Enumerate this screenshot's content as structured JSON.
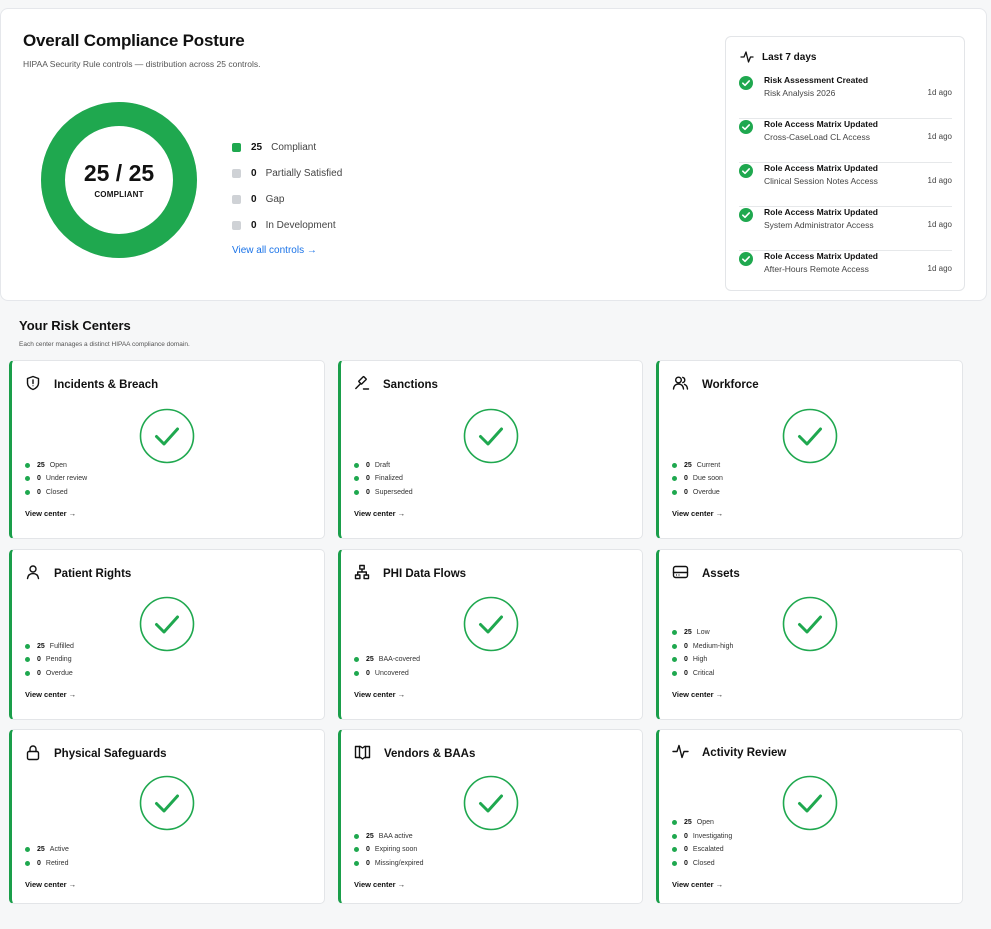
{
  "posture": {
    "title": "Overall Compliance Posture",
    "subtitle": "HIPAA Security Rule controls — distribution across 25 controls.",
    "donut_count": "25 / 25",
    "donut_label": "COMPLIANT",
    "compliant_fraction": 1.0,
    "legend": [
      {
        "count": "25",
        "label": "Compliant",
        "color": "#1fa84f"
      },
      {
        "count": "0",
        "label": "Partially Satisfied",
        "color": "#cfd2d6"
      },
      {
        "count": "0",
        "label": "Gap",
        "color": "#cfd2d6"
      },
      {
        "count": "0",
        "label": "In Development",
        "color": "#cfd2d6"
      }
    ],
    "view_all_label": "View all controls →"
  },
  "activity": {
    "title": "Last 7 days",
    "icon": "activity-pulse-icon",
    "items": [
      {
        "title": "Risk Assessment Created",
        "subtitle": "Risk Analysis 2026",
        "time": "1d ago"
      },
      {
        "title": "Role Access Matrix Updated",
        "subtitle": "Cross-CaseLoad CL Access",
        "time": "1d ago"
      },
      {
        "title": "Role Access Matrix Updated",
        "subtitle": "Clinical Session Notes Access",
        "time": "1d ago"
      },
      {
        "title": "Role Access Matrix Updated",
        "subtitle": "System Administrator Access",
        "time": "1d ago"
      },
      {
        "title": "Role Access Matrix Updated",
        "subtitle": "After-Hours Remote Access",
        "time": "1d ago"
      }
    ]
  },
  "risk_centers": {
    "title": "Your Risk Centers",
    "subtitle": "Each center manages a distinct HIPAA compliance domain.",
    "view_label": "View center →",
    "cards": [
      {
        "title": "Incidents & Breach",
        "icon": "shield-alert-icon",
        "stats": [
          {
            "count": "25",
            "label": "Open"
          },
          {
            "count": "0",
            "label": "Under review"
          },
          {
            "count": "0",
            "label": "Closed"
          }
        ]
      },
      {
        "title": "Sanctions",
        "icon": "gavel-icon",
        "stats": [
          {
            "count": "0",
            "label": "Draft"
          },
          {
            "count": "0",
            "label": "Finalized"
          },
          {
            "count": "0",
            "label": "Superseded"
          }
        ]
      },
      {
        "title": "Workforce",
        "icon": "users-icon",
        "stats": [
          {
            "count": "25",
            "label": "Current"
          },
          {
            "count": "0",
            "label": "Due soon"
          },
          {
            "count": "0",
            "label": "Overdue"
          }
        ]
      },
      {
        "title": "Patient Rights",
        "icon": "user-icon",
        "stats": [
          {
            "count": "25",
            "label": "Fulfilled"
          },
          {
            "count": "0",
            "label": "Pending"
          },
          {
            "count": "0",
            "label": "Overdue"
          }
        ]
      },
      {
        "title": "PHI Data Flows",
        "icon": "network-icon",
        "stats": [
          {
            "count": "25",
            "label": "BAA-covered"
          },
          {
            "count": "0",
            "label": "Uncovered"
          }
        ]
      },
      {
        "title": "Assets",
        "icon": "hard-drive-icon",
        "stats": [
          {
            "count": "25",
            "label": "Low"
          },
          {
            "count": "0",
            "label": "Medium-high"
          },
          {
            "count": "0",
            "label": "High"
          },
          {
            "count": "0",
            "label": "Critical"
          }
        ]
      },
      {
        "title": "Physical Safeguards",
        "icon": "lock-icon",
        "stats": [
          {
            "count": "25",
            "label": "Active"
          },
          {
            "count": "0",
            "label": "Retired"
          }
        ]
      },
      {
        "title": "Vendors & BAAs",
        "icon": "map-book-icon",
        "stats": [
          {
            "count": "25",
            "label": "BAA active"
          },
          {
            "count": "0",
            "label": "Expiring soon"
          },
          {
            "count": "0",
            "label": "Missing/expired"
          }
        ]
      },
      {
        "title": "Activity Review",
        "icon": "activity-pulse-icon",
        "stats": [
          {
            "count": "25",
            "label": "Open"
          },
          {
            "count": "0",
            "label": "Investigating"
          },
          {
            "count": "0",
            "label": "Escalated"
          },
          {
            "count": "0",
            "label": "Closed"
          }
        ]
      }
    ]
  },
  "colors": {
    "accent_green": "#1fa84f",
    "link_blue": "#1a73e8",
    "neutral_gray": "#cfd2d6"
  }
}
